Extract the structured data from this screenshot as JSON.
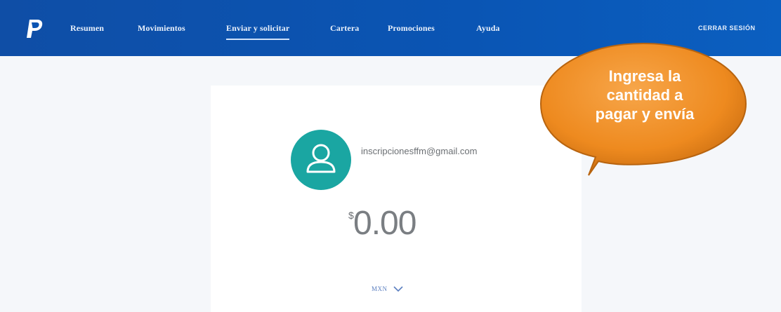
{
  "nav": {
    "items": [
      "Resumen",
      "Movimientos",
      "Enviar y solicitar",
      "Cartera",
      "Promociones",
      "Ayuda"
    ],
    "active": "Enviar y solicitar",
    "logout": "CERRAR SESIÓN"
  },
  "payment": {
    "recipient": "inscripcionesffm@gmail.com",
    "currency_symbol": "$",
    "amount": "0.00",
    "currency": "MXN"
  },
  "callout": {
    "text": "Ingresa la cantidad a pagar y envía"
  },
  "colors": {
    "header": "#0b54b3",
    "avatar": "#1aa6a2",
    "callout": "#ef8a1c",
    "page_bg": "#f5f7fa"
  },
  "icons": [
    "paypal-logo-icon",
    "user-icon",
    "chevron-down-icon"
  ]
}
